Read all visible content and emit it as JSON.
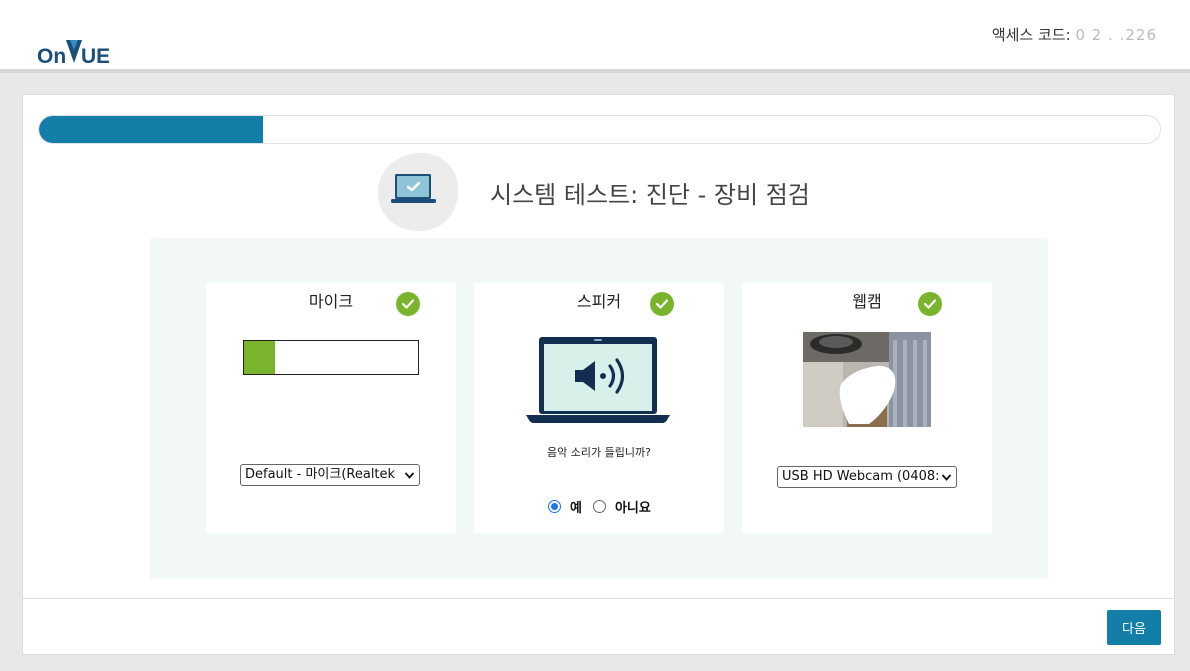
{
  "header": {
    "logo_text": "OnVUE",
    "access_code_label": "액세스 코드:",
    "access_code_value": "0  2     .  .226"
  },
  "progress": {
    "value": 0.2
  },
  "page": {
    "title": "시스템 테스트: 진단 - 장비 점검"
  },
  "devices": {
    "mic": {
      "title": "마이크",
      "level": 0.18,
      "selected": "Default - 마이크(Realtek"
    },
    "speaker": {
      "title": "스피커",
      "question": "음악 소리가 들립니까?",
      "yes_label": "예",
      "no_label": "아니요",
      "selected": "yes"
    },
    "webcam": {
      "title": "웹캠",
      "selected": "USB HD Webcam (0408:"
    }
  },
  "footer": {
    "next_label": "다음"
  },
  "colors": {
    "accent": "#137ea7",
    "success": "#7ab42d",
    "panel_bg": "#f2f8f6"
  }
}
